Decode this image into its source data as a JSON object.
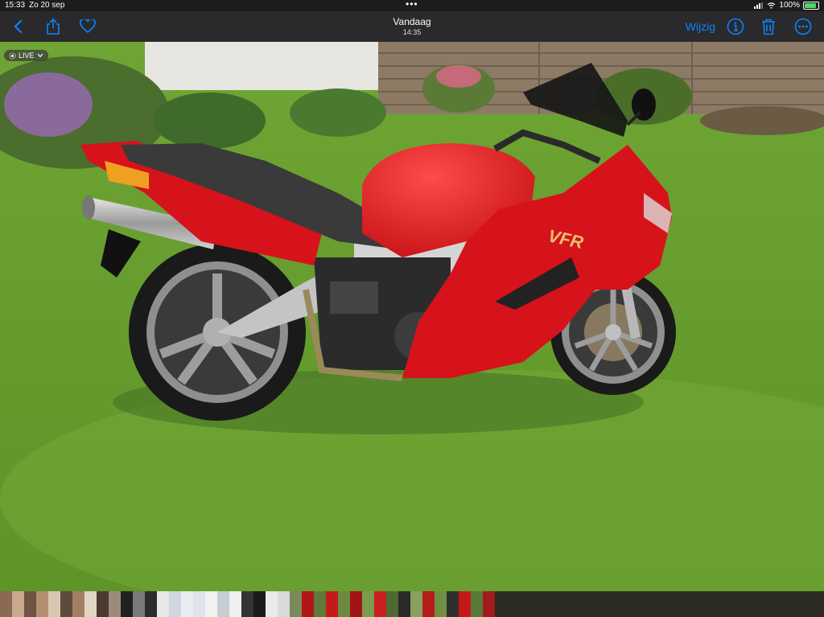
{
  "status": {
    "time": "15:33",
    "date": "Zo 20 sep",
    "battery": "100%"
  },
  "toolbar": {
    "title": "Vandaag",
    "subtitle": "14:35",
    "edit_label": "Wijzig"
  },
  "live_label": "LIVE",
  "icons": [
    "back-chevron-icon",
    "share-icon",
    "heart-icon",
    "info-icon",
    "trash-icon",
    "more-icon"
  ],
  "colors": {
    "accent": "#0a84ff",
    "bike_red": "#d6121a"
  },
  "filmstrip": {
    "thumb_colors": [
      "#8a6a52",
      "#c9a98c",
      "#6e5442",
      "#b39074",
      "#d8c6b1",
      "#5d4b3d",
      "#a38065",
      "#e2d5c4",
      "#4a3a2f",
      "#9a8c7a",
      "#202020",
      "#7a7a7a",
      "#2c2c2c",
      "#e8e8e8",
      "#cfd6e0",
      "#e9ecef",
      "#dfe4ea",
      "#f1f1f1",
      "#c6ccd4",
      "#efefef",
      "#343434",
      "#1b1b1b",
      "#eaeaea",
      "#d9d9d9",
      "#7a8a5a",
      "#b01818",
      "#5f7a3a",
      "#c41a1a",
      "#6b8a40",
      "#a11515",
      "#7c9b4b",
      "#c82020",
      "#4e6a32",
      "#2a2a2a",
      "#8a9f60",
      "#b51c1c",
      "#6f8f44",
      "#2f2f2f",
      "#c41818",
      "#5a7a3a",
      "#a31a1a"
    ]
  }
}
